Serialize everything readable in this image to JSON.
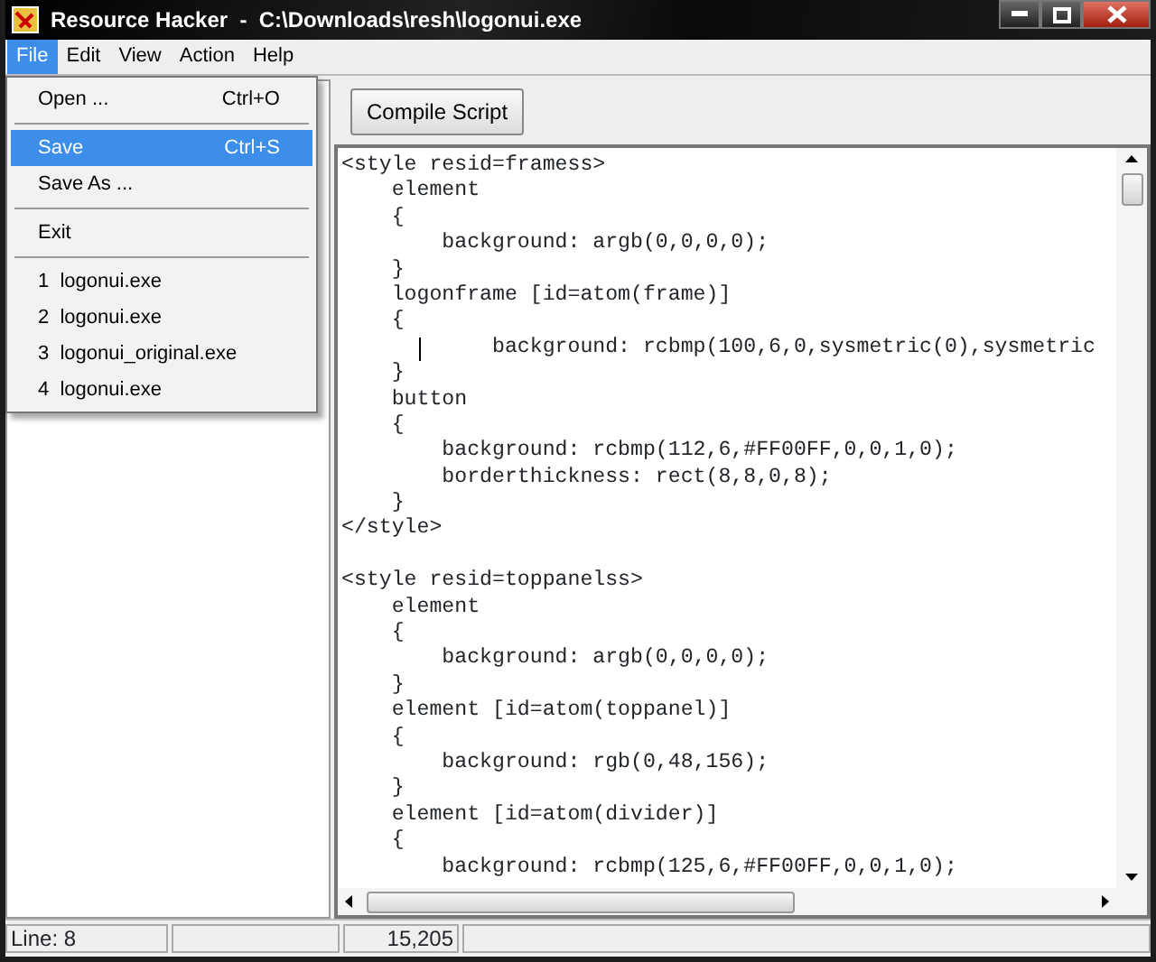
{
  "window": {
    "title": "Resource Hacker  -  C:\\Downloads\\resh\\logonui.exe"
  },
  "menu_bar": [
    {
      "label": "File",
      "selected": true
    },
    {
      "label": "Edit",
      "selected": false
    },
    {
      "label": "View",
      "selected": false
    },
    {
      "label": "Action",
      "selected": false
    },
    {
      "label": "Help",
      "selected": false
    }
  ],
  "file_menu": [
    {
      "kind": "item",
      "label": "Open ...",
      "shortcut": "Ctrl+O",
      "selected": false
    },
    {
      "kind": "separator"
    },
    {
      "kind": "item",
      "label": "Save",
      "shortcut": "Ctrl+S",
      "selected": true
    },
    {
      "kind": "item",
      "label": "Save As ...",
      "selected": false
    },
    {
      "kind": "separator"
    },
    {
      "kind": "item",
      "label": "Exit",
      "selected": false
    },
    {
      "kind": "separator"
    },
    {
      "kind": "item",
      "label": "1  logonui.exe",
      "selected": false
    },
    {
      "kind": "item",
      "label": "2  logonui.exe",
      "selected": false
    },
    {
      "kind": "item",
      "label": "3  logonui_original.exe",
      "selected": false
    },
    {
      "kind": "item",
      "label": "4  logonui.exe",
      "selected": false
    }
  ],
  "toolbar": {
    "compile_button": "Compile Script"
  },
  "editor": {
    "lines": [
      {
        "text": "<style resid=framess>",
        "caret": false
      },
      {
        "text": "    element",
        "caret": false
      },
      {
        "text": "    {",
        "caret": false
      },
      {
        "text": "        background: argb(0,0,0,0);",
        "caret": false
      },
      {
        "text": "    }",
        "caret": false
      },
      {
        "text": "    logonframe [id=atom(frame)]",
        "caret": false
      },
      {
        "text": "    {",
        "caret": false
      },
      {
        "text": "            background: rcbmp(100,6,0,sysmetric(0),sysmetric",
        "caret": true
      },
      {
        "text": "    }",
        "caret": false
      },
      {
        "text": "    button",
        "caret": false
      },
      {
        "text": "    {",
        "caret": false
      },
      {
        "text": "        background: rcbmp(112,6,#FF00FF,0,0,1,0);",
        "caret": false
      },
      {
        "text": "        borderthickness: rect(8,8,0,8);",
        "caret": false
      },
      {
        "text": "    }",
        "caret": false
      },
      {
        "text": "</style>",
        "caret": false
      },
      {
        "caret": false
      },
      {
        "text": "<style resid=toppanelss>",
        "caret": false
      },
      {
        "text": "    element",
        "caret": false
      },
      {
        "text": "    {",
        "caret": false
      },
      {
        "text": "        background: argb(0,0,0,0);",
        "caret": false
      },
      {
        "text": "    }",
        "caret": false
      },
      {
        "text": "    element [id=atom(toppanel)]",
        "caret": false
      },
      {
        "text": "    {",
        "caret": false
      },
      {
        "text": "        background: rgb(0,48,156);",
        "caret": false
      },
      {
        "text": "    }",
        "caret": false
      },
      {
        "text": "    element [id=atom(divider)]",
        "caret": false
      },
      {
        "text": "    {",
        "caret": false
      },
      {
        "text": "        background: rcbmp(125,6,#FF00FF,0,0,1,0);",
        "caret": false
      }
    ]
  },
  "status_bar": {
    "line": "Line: 8",
    "size": "15,205"
  }
}
